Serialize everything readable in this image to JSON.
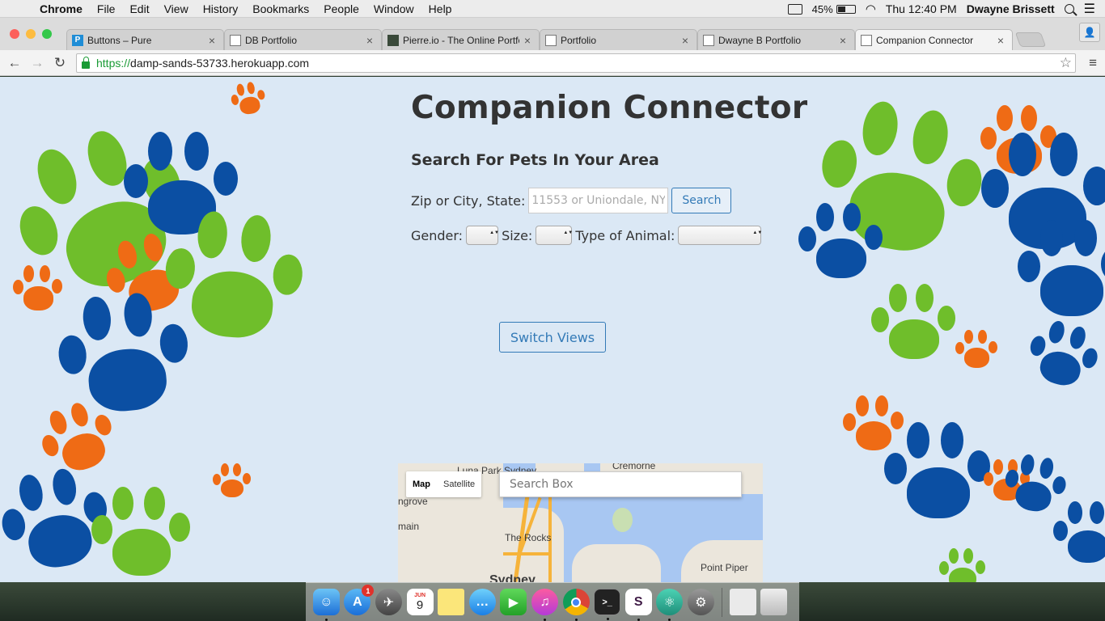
{
  "menubar": {
    "app_name": "Chrome",
    "items": [
      "File",
      "Edit",
      "View",
      "History",
      "Bookmarks",
      "People",
      "Window",
      "Help"
    ],
    "battery": "45%",
    "clock": "Thu 12:40 PM",
    "user": "Dwayne Brissett"
  },
  "tabs": [
    {
      "title": "Buttons – Pure",
      "active": false
    },
    {
      "title": "DB Portfolio",
      "active": false
    },
    {
      "title": "Pierre.io - The Online Portfo",
      "active": false
    },
    {
      "title": "Portfolio",
      "active": false
    },
    {
      "title": "Dwayne B Portfolio",
      "active": false
    },
    {
      "title": "Companion Connector",
      "active": true
    }
  ],
  "address_bar": {
    "scheme": "https://",
    "host": "damp-sands-53733.herokuapp.com"
  },
  "page": {
    "title": "Companion Connector",
    "subtitle": "Search For Pets In Your Area",
    "location_label": "Zip or City, State:",
    "location_placeholder": "11553 or Uniondale, NY",
    "search_button": "Search",
    "gender_label": "Gender:",
    "size_label": "Size:",
    "animal_label": "Type of Animal:",
    "switch_views_button": "Switch Views"
  },
  "map": {
    "map_type_options": [
      "Map",
      "Satellite"
    ],
    "selected_type": "Map",
    "search_placeholder": "Search Box",
    "labels": [
      "Luna Park Sydney",
      "Cremorne",
      "ngrove",
      "main",
      "The Rocks",
      "Point Piper",
      "Sydney"
    ]
  },
  "dock": {
    "app_store_badge": "1",
    "calendar_month": "JUN",
    "calendar_day": "9"
  },
  "colors": {
    "page_bg": "#dbe8f5",
    "accent": "#337ab7",
    "paw_green": "#6fbe2b",
    "paw_blue": "#0b4fa3",
    "paw_orange": "#ef6b15"
  }
}
